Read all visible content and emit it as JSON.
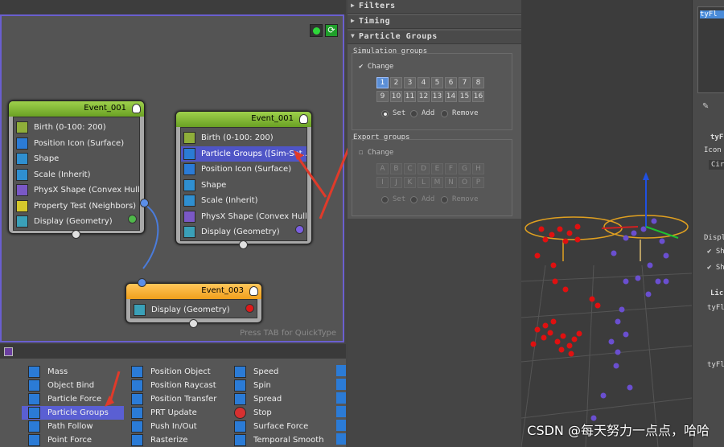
{
  "editor": {
    "tab_hint": "Press TAB for QuickType",
    "nodes": [
      {
        "title": "Event_001",
        "color": "#7ab32e",
        "operators": [
          "Birth (0-100: 200)",
          "Position Icon (Surface)",
          "Shape",
          "Scale (Inherit)",
          "PhysX Shape (Convex Hull)",
          "Property Test (Neighbors)",
          "Display (Geometry)"
        ]
      },
      {
        "title": "Event_001",
        "color": "#7ab32e",
        "operators": [
          "Birth (0-100: 200)",
          "Particle Groups ([Sim-Set...",
          "Position Icon (Surface)",
          "Shape",
          "Scale (Inherit)",
          "PhysX Shape (Convex Hull)",
          "Display (Geometry)"
        ]
      },
      {
        "title": "Event_003",
        "color": "#f5a623",
        "operators": [
          "Display (Geometry)"
        ]
      }
    ]
  },
  "operator_list": {
    "col1": [
      "Mass",
      "Object Bind",
      "Particle Force",
      "Particle Groups",
      "Path Follow",
      "Point Force"
    ],
    "col2": [
      "Position Object",
      "Position Raycast",
      "Position Transfer",
      "PRT Update",
      "Push In/Out",
      "Rasterize"
    ],
    "col3": [
      "Speed",
      "Spin",
      "Spread",
      "Stop",
      "Surface Force",
      "Temporal Smooth"
    ],
    "highlighted": "Particle Groups"
  },
  "panel": {
    "rollouts": [
      "Filters",
      "Timing",
      "Particle Groups"
    ],
    "sim_groups_title": "Simulation groups",
    "change_label": "Change",
    "numbers": [
      "1",
      "2",
      "3",
      "4",
      "5",
      "6",
      "7",
      "8",
      "9",
      "10",
      "11",
      "12",
      "13",
      "14",
      "15",
      "16"
    ],
    "export_groups_title": "Export groups",
    "letters": [
      "A",
      "B",
      "C",
      "D",
      "E",
      "F",
      "G",
      "H",
      "I",
      "J",
      "K",
      "L",
      "M",
      "N",
      "O",
      "P"
    ],
    "set_label": "Set",
    "add_label": "Add",
    "remove_label": "Remove"
  },
  "sidebar": {
    "item": "tyFl",
    "rollout1": "tyF",
    "icon_label": "Icon",
    "cir": "Cir",
    "display": "Displ",
    "sh1": "Sh",
    "sh2": "Sh",
    "lic": "Lic",
    "tyfl2": "tyFl",
    "tyfl3": "tyFl"
  },
  "watermark": "CSDN @每天努力一点点，哈哈",
  "colors": {
    "accent": "#5a5fd3",
    "arrow": "#e03a2a",
    "red_particle": "#e01010",
    "purple_particle": "#6a4fd0"
  }
}
